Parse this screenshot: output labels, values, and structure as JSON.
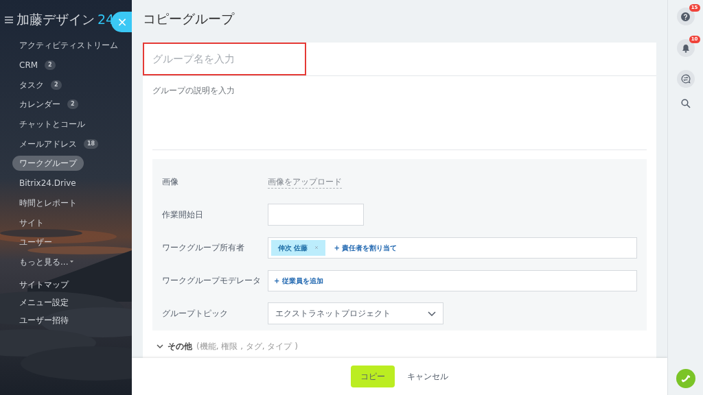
{
  "logo": {
    "name": "加藤デザイン",
    "number": "24"
  },
  "close_button": "×",
  "sidebar": {
    "items": [
      {
        "label": "アクティビティストリーム",
        "selected": false
      },
      {
        "label": "CRM",
        "count": "2",
        "selected": false
      },
      {
        "label": "タスク",
        "count": "2",
        "selected": false
      },
      {
        "label": "カレンダー",
        "count": "2",
        "selected": false
      },
      {
        "label": "チャットとコール",
        "selected": false
      },
      {
        "label": "メールアドレス",
        "count": "18",
        "selected": false
      },
      {
        "label": "ワークグループ",
        "selected": true
      },
      {
        "label": "Bitrix24.Drive",
        "selected": false
      },
      {
        "label": "時間とレポート",
        "selected": false
      },
      {
        "label": "サイト",
        "selected": false
      },
      {
        "label": "ユーザー",
        "selected": false
      }
    ],
    "more": "もっと見る...",
    "links": [
      "サイトマップ",
      "メニュー設定",
      "ユーザー招待"
    ]
  },
  "title": "コピーグループ",
  "form": {
    "name_placeholder": "グループ名を入力",
    "description_placeholder": "グループの説明を入力",
    "fields": [
      {
        "kind": "upload",
        "label": "画像",
        "link": "画像をアップロード"
      },
      {
        "kind": "date",
        "label": "作業開始日"
      },
      {
        "kind": "people",
        "label": "ワークグループ所有者",
        "tags": [
          "伸次 佐藤"
        ],
        "add": "+ 責任者を割り当て"
      },
      {
        "kind": "people",
        "label": "ワークグループモデレータ",
        "add": "+ 従業員を追加"
      },
      {
        "kind": "select",
        "label": "グループトピック",
        "value": "エクストラネットプロジェクト"
      }
    ],
    "more": {
      "label": "その他",
      "hint": "(機能, 権限 , タグ, タイプ )"
    }
  },
  "buttons": {
    "copy": "コピー",
    "cancel": "キャンセル"
  },
  "right_bar": {
    "help_count": "15",
    "notification_count": "10"
  }
}
